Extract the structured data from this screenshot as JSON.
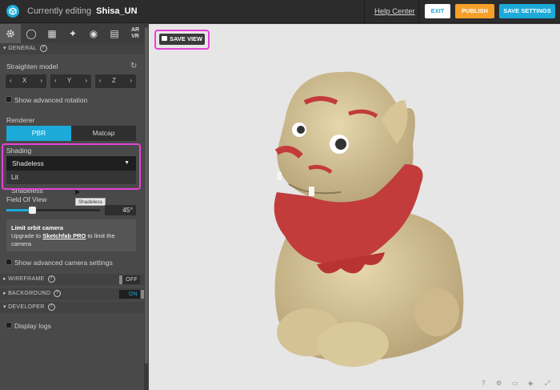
{
  "header": {
    "title_prefix": "Currently editing",
    "model_name": "Shisa_UN",
    "help_link": "Help Center",
    "exit_label": "EXIT",
    "publish_label": "PUBLISH",
    "save_settings_label": "SAVE SETTINGS"
  },
  "tabs": {
    "arvr_label_line1": "AR",
    "arvr_label_line2": "VR"
  },
  "general": {
    "section_label": "GENERAL",
    "straighten_label": "Straighten model",
    "axes": [
      {
        "left": "‹",
        "axis": "X",
        "right": "›"
      },
      {
        "left": "‹",
        "axis": "Y",
        "right": "›"
      },
      {
        "left": "‹",
        "axis": "Z",
        "right": "›"
      }
    ],
    "advanced_rotation_label": "Show advanced rotation",
    "renderer_label": "Renderer",
    "renderer_options": [
      "PBR",
      "Matcap"
    ],
    "shading_label": "Shading",
    "shading_selected": "Shadeless",
    "shading_menu_item": "Lit",
    "shading_obscured_value": "Shadeless",
    "tooltip": "Shadeless",
    "fov_label": "Field Of View",
    "fov_value": "45°",
    "fov_fraction": 0.27,
    "limit_orbit_title": "Limit orbit camera",
    "limit_orbit_prefix": "Upgrade to ",
    "limit_orbit_link": "Sketchfab PRO",
    "limit_orbit_suffix": " to limit the camera",
    "advanced_camera_label": "Show advanced camera settings"
  },
  "wireframe": {
    "section_label": "WIREFRAME",
    "toggle": "OFF"
  },
  "background": {
    "section_label": "BACKGROUND",
    "toggle": "ON"
  },
  "developer": {
    "section_label": "DEVELOPER",
    "display_logs_label": "Display logs"
  },
  "viewport": {
    "save_view_label": "SAVE VIEW"
  },
  "colors": {
    "accent": "#1caad9",
    "publish": "#f6a02a",
    "highlight": "#e542d8"
  }
}
